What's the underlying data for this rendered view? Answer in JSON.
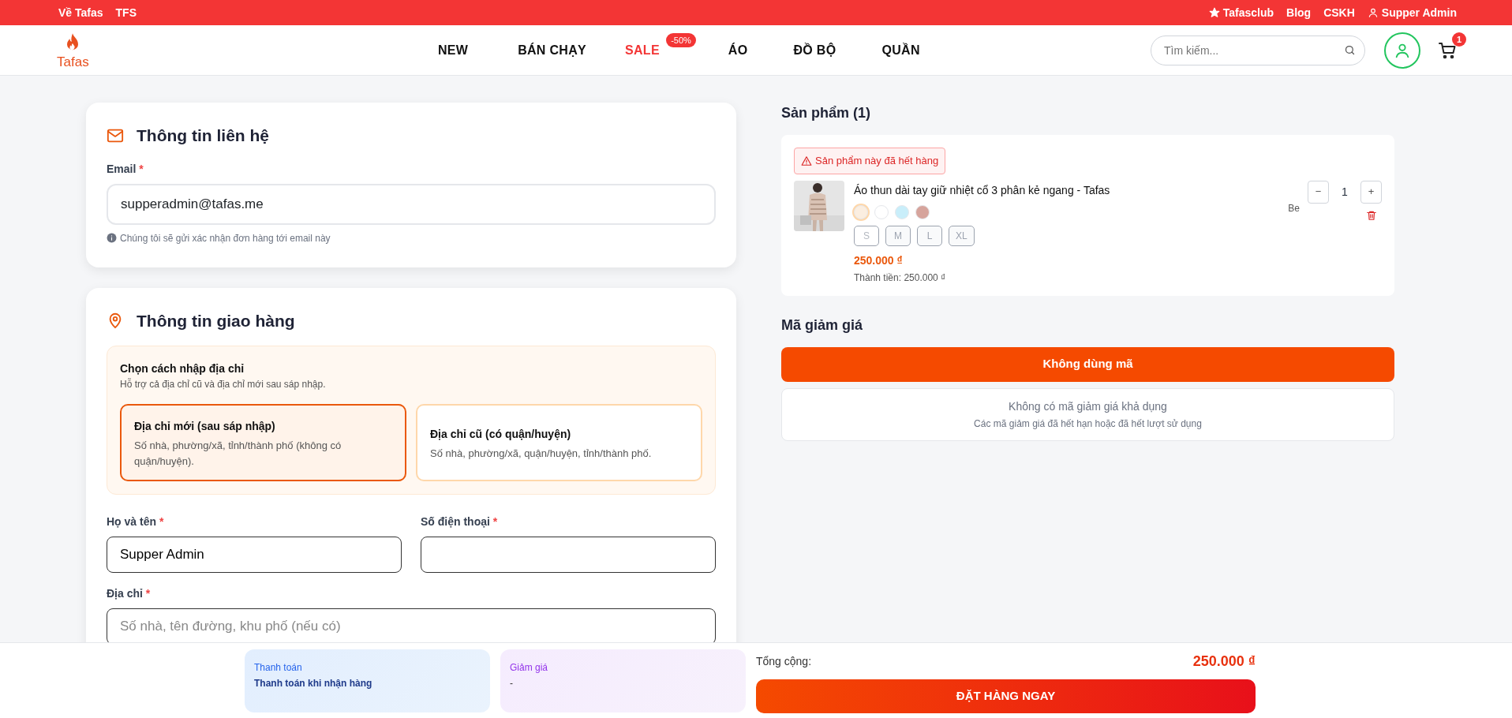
{
  "topbar": {
    "left_links": [
      "Về Tafas",
      "TFS"
    ],
    "right_links": [
      {
        "label": "Tafasclub",
        "kind": "club"
      },
      {
        "label": "Blog",
        "kind": "link"
      },
      {
        "label": "CSKH",
        "kind": "link"
      },
      {
        "label": "Supper Admin",
        "kind": "account"
      }
    ]
  },
  "header": {
    "logo_text": "Tafas",
    "nav": [
      {
        "label": "NEW",
        "highlighted": false
      },
      {
        "label": "BÁN CHẠY",
        "highlighted": false
      },
      {
        "label": "SALE",
        "highlighted": true,
        "badge": "-50%"
      },
      {
        "label": "ÁO",
        "highlighted": false
      },
      {
        "label": "ĐỒ BỘ",
        "highlighted": false
      },
      {
        "label": "QUẦN",
        "highlighted": false
      }
    ],
    "search": {
      "placeholder": "Tìm kiếm..."
    },
    "cart_count": "1"
  },
  "contact": {
    "title": "Thông tin liên hệ",
    "email": {
      "label": "Email",
      "required_mark": "*",
      "value": "supperadmin@tafas.me"
    },
    "hint": "Chúng tôi sẽ gửi xác nhận đơn hàng tới email này"
  },
  "shipping": {
    "title": "Thông tin giao hàng",
    "mode_box": {
      "title": "Chọn cách nhập địa chỉ",
      "subtitle": "Hỗ trợ cả địa chỉ cũ và địa chỉ mới sau sáp nhập.",
      "options": [
        {
          "title": "Địa chỉ mới (sau sáp nhập)",
          "description": "Số nhà, phường/xã, tỉnh/thành phố (không có quận/huyện).",
          "selected": true
        },
        {
          "title": "Địa chỉ cũ (có quận/huyện)",
          "description": "Số nhà, phường/xã, quận/huyện, tỉnh/thành phố.",
          "selected": false
        }
      ]
    },
    "field_rows": [
      [
        {
          "label": "Họ và tên",
          "required_mark": "*",
          "value": "Supper Admin"
        },
        {
          "label": "Số điện thoại",
          "required_mark": "*"
        }
      ],
      [
        {
          "label": "Địa chỉ",
          "required_mark": "*",
          "placeholder": "Số nhà, tên đường, khu phố (nếu có)"
        }
      ]
    ]
  },
  "products": {
    "title": "Sản phẩm (1)",
    "items": [
      {
        "warning": "Sản phẩm này đã hết hàng",
        "name": "Áo thun dài tay giữ nhiệt cổ 3 phân kẻ ngang - Tafas",
        "colors": [
          {
            "color": "#fbeee0",
            "selected": true
          },
          {
            "color": "#ffffff",
            "selected": false
          },
          {
            "color": "#c9eefa",
            "selected": false
          },
          {
            "color": "#d6a49c",
            "selected": false
          }
        ],
        "sizes": [
          {
            "label": "S",
            "available": false
          },
          {
            "label": "M",
            "available": true
          },
          {
            "label": "L",
            "available": true
          },
          {
            "label": "XL",
            "available": true
          }
        ],
        "price": "250.000 ₫",
        "subtotal": "Thành tiền: 250.000 ₫",
        "variant": "Be",
        "minus": "−",
        "quantity": "1",
        "plus": "+"
      }
    ]
  },
  "discount": {
    "title": "Mã giảm giá",
    "button": "Không dùng mã",
    "empty_title": "Không có mã giảm giá khả dụng",
    "empty_subtitle": "Các mã giảm giá đã hết hạn hoặc đã hết lượt sử dụng"
  },
  "summary": {
    "payment": {
      "label": "Thanh toán",
      "value": "Thanh toán khi nhận hàng"
    },
    "discount": {
      "label": "Giảm giá",
      "value": "-"
    },
    "total_label": "Tổng cộng:",
    "total": "250.000 ₫",
    "order_button": "ĐẶT HÀNG NGAY"
  }
}
